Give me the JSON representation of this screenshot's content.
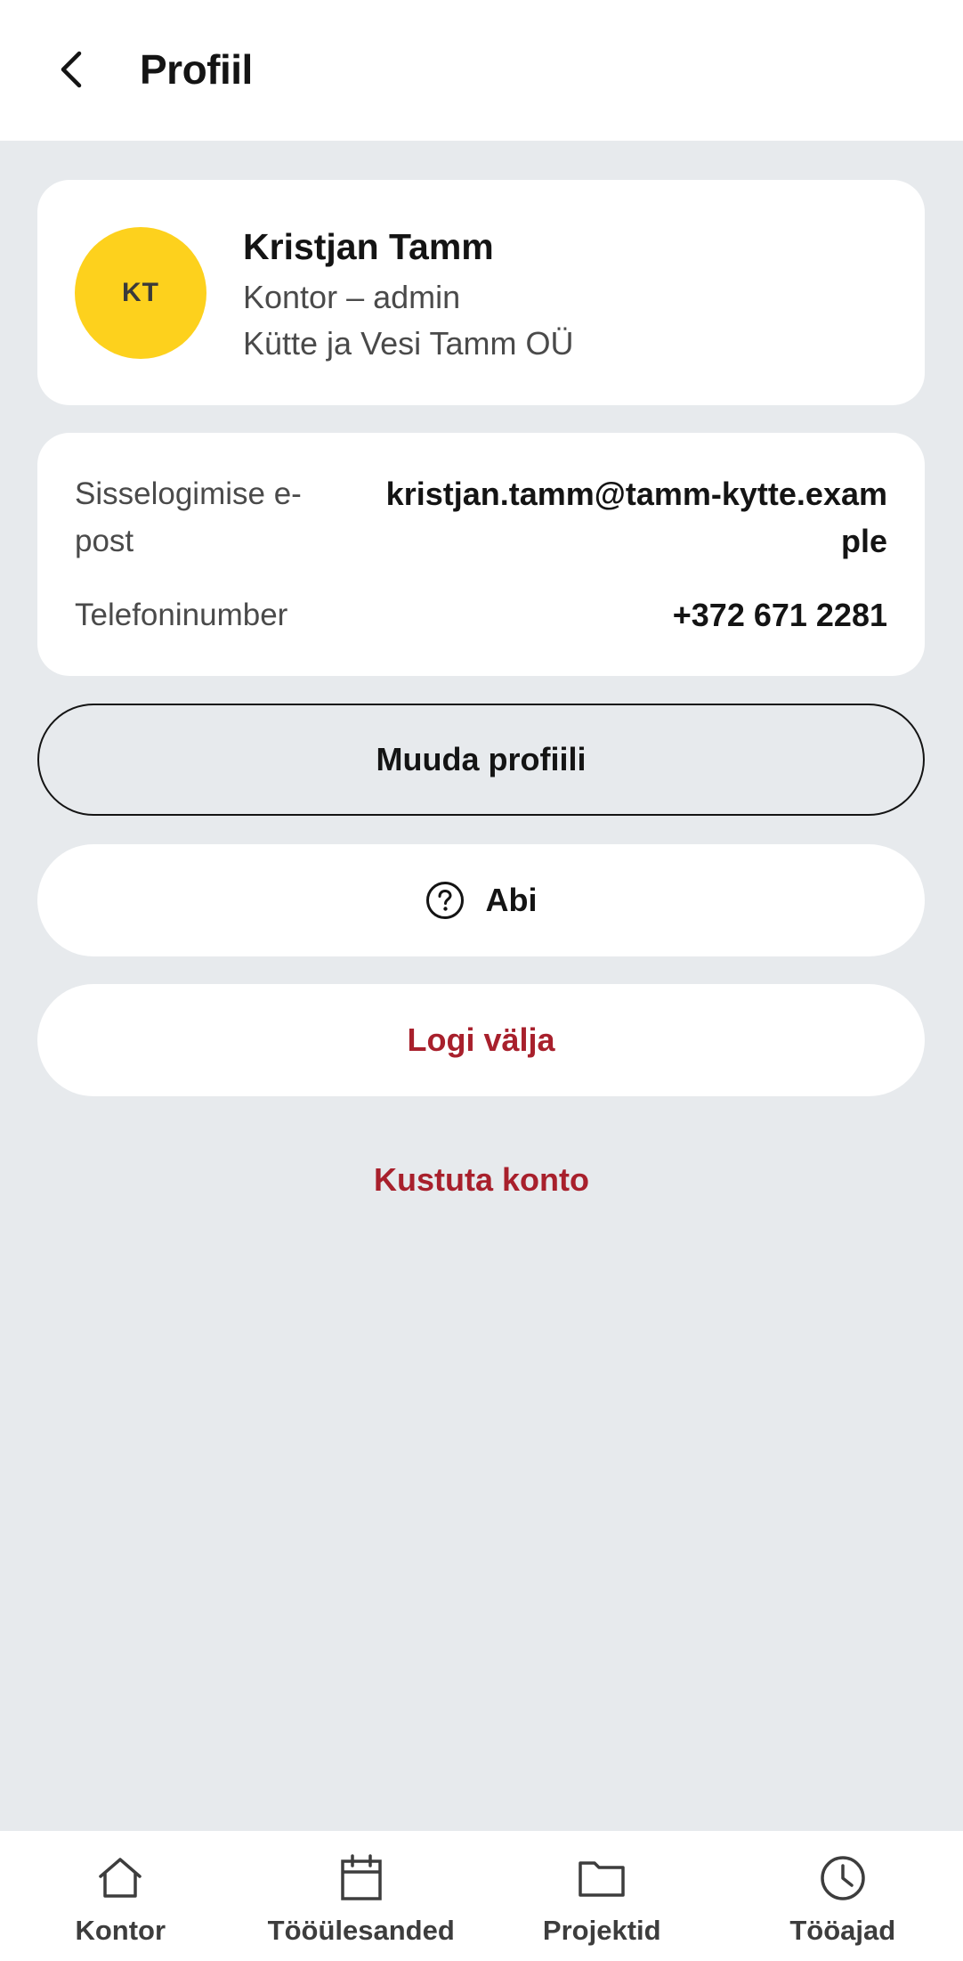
{
  "header": {
    "back_icon": "chevron-left-icon",
    "title": "Profiil"
  },
  "profile": {
    "initials": "KT",
    "name": "Kristjan Tamm",
    "role": "Kontor – admin",
    "company": "Kütte ja Vesi Tamm OÜ",
    "avatar_color": "#fdd11d"
  },
  "info": {
    "email_label": "Sisselogimise e-post",
    "email_value": "kristjan.tamm@tamm-kytte.example",
    "phone_label": "Telefoninumber",
    "phone_value": "+372 671 2281"
  },
  "actions": {
    "edit_label": "Muuda profiili",
    "help_label": "Abi",
    "help_icon": "question-circle-icon",
    "logout_label": "Logi välja",
    "delete_label": "Kustuta konto",
    "danger_color": "#a8202c"
  },
  "bottom_nav": {
    "items": [
      {
        "label": "Kontor",
        "icon": "home-icon"
      },
      {
        "label": "Tööülesanded",
        "icon": "calendar-icon"
      },
      {
        "label": "Projektid",
        "icon": "folder-icon"
      },
      {
        "label": "Tööajad",
        "icon": "clock-icon"
      }
    ]
  }
}
